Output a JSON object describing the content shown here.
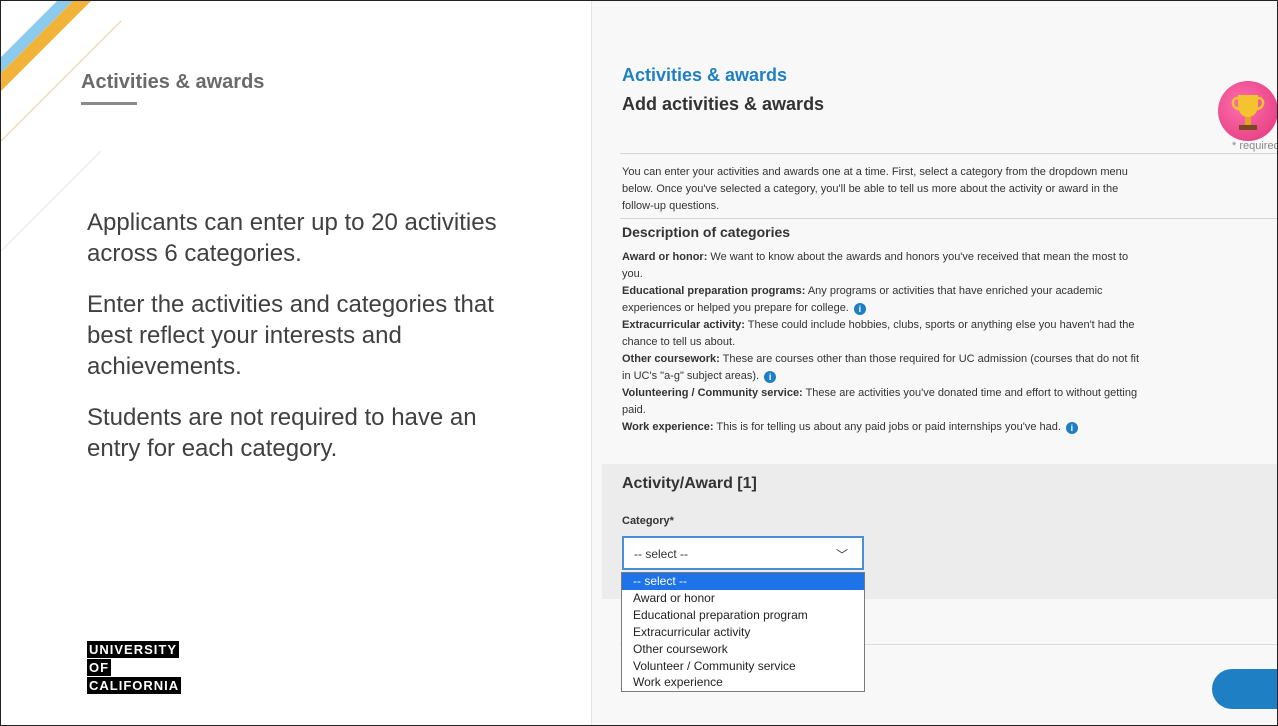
{
  "slide": {
    "title": "Activities & awards",
    "paragraphs": [
      "Applicants can enter up to 20 activities across 6 categories.",
      "Enter the activities and categories that best reflect your interests and achievements.",
      "Students are not required to have an entry for each category."
    ],
    "logo_lines": [
      "UNIVERSITY",
      "OF",
      "CALIFORNIA"
    ]
  },
  "app": {
    "section_title": "Activities & awards",
    "page_heading": "Add activities & awards",
    "required_note": "* required",
    "intro": "You can enter your activities and awards one at a time. First, select a category from the dropdown menu below. Once you've selected a category, you'll be able to tell us more about the activity or award in the follow-up questions.",
    "description_heading": "Description of categories",
    "descriptions": [
      {
        "label": "Award or honor:",
        "text": " We want to know about the awards and honors you've received that mean the most to you."
      },
      {
        "label": "Educational preparation programs:",
        "text": " Any programs or activities that have enriched your academic experiences or helped you prepare for college."
      },
      {
        "label": "Extracurricular activity:",
        "text": " These could include hobbies, clubs, sports or anything else you haven't had the chance to tell us about."
      },
      {
        "label": "Other coursework:",
        "text": " These are courses other than those required for UC admission (courses that do not fit in UC's \"a-g\" subject areas)."
      },
      {
        "label": "Volunteering / Community service:",
        "text": " These are activities you've donated time and effort to without getting paid."
      },
      {
        "label": "Work experience:",
        "text": " This is for telling us about any paid jobs or paid internships you've had."
      }
    ],
    "info_icon_glyph": "i",
    "card_title": "Activity/Award [1]",
    "category_label": "Category*",
    "select_value": "-- select --",
    "chevron_glyph": "﹀",
    "options": [
      "-- select --",
      "Award or honor",
      "Educational preparation program",
      "Extracurricular activity",
      "Other coursework",
      "Volunteer / Community service",
      "Work experience"
    ],
    "colors": {
      "accent": "#1e7fc4",
      "selected_option": "#1e73e8",
      "trophy": "#e0357a"
    },
    "icons": [
      "trophy-icon",
      "info-icon",
      "chevron-down-icon"
    ]
  }
}
